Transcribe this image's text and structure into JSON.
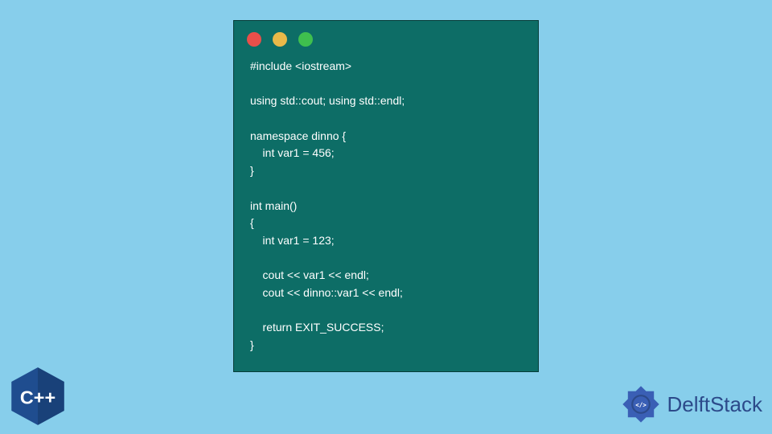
{
  "window": {
    "dots": [
      "red",
      "yellow",
      "green"
    ]
  },
  "code": {
    "lines": [
      "#include <iostream>",
      "",
      "using std::cout; using std::endl;",
      "",
      "namespace dinno {",
      "    int var1 = 456;",
      "}",
      "",
      "int main()",
      "{",
      "    int var1 = 123;",
      "",
      "    cout << var1 << endl;",
      "    cout << dinno::var1 << endl;",
      "",
      "    return EXIT_SUCCESS;",
      "}"
    ]
  },
  "badges": {
    "cpp_label": "C++",
    "brand_name": "DelftStack"
  },
  "colors": {
    "page_bg": "#87ceeb",
    "window_bg": "#0d6d66",
    "code_text": "#ffffff",
    "brand_text": "#2c4a8a",
    "brand_accent": "#3a5fb5",
    "cpp_hex": "#1f4d8f"
  }
}
